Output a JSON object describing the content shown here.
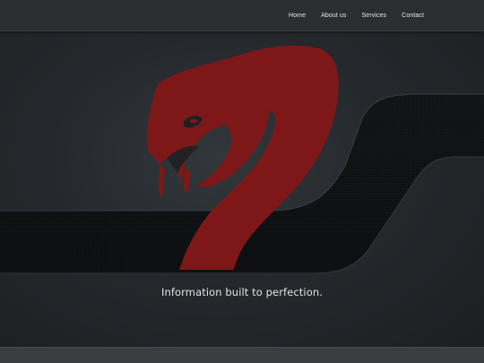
{
  "nav": {
    "items": [
      {
        "label": "Home"
      },
      {
        "label": "About us"
      },
      {
        "label": "Services"
      },
      {
        "label": "Contact"
      }
    ]
  },
  "hero": {
    "tagline": "Information built to perfection.",
    "logo_icon": "cobra-snake-logo",
    "brand_color": "#8b1a1a"
  },
  "colors": {
    "navbar": "#2b2d2f",
    "background": "#1e2124",
    "band": "#111315",
    "footer": "#3b3d3f"
  }
}
